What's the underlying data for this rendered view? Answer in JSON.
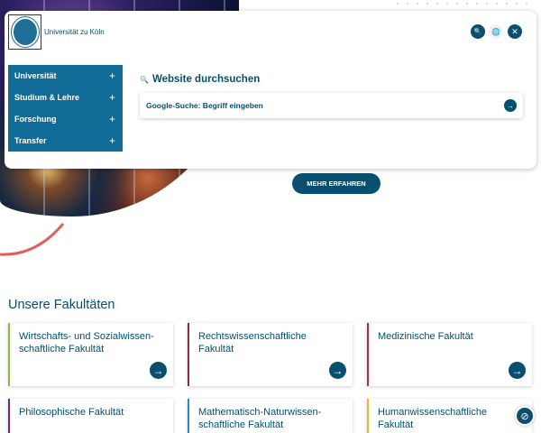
{
  "header": {
    "university_name": "Universität zu Köln",
    "logo_text": "Universität zu Köln"
  },
  "icons": {
    "search": "🔍",
    "globe": "🌐",
    "close": "✕",
    "arrow": "→",
    "compass": "⊘"
  },
  "menu": {
    "items": [
      {
        "label": "Universität"
      },
      {
        "label": "Studium & Lehre"
      },
      {
        "label": "Forschung"
      },
      {
        "label": "Transfer"
      }
    ],
    "expand_symbol": "+"
  },
  "search": {
    "title": "Website durchsuchen",
    "placeholder": "Google-Suche: Begriff eingeben"
  },
  "hero": {
    "button_label": "MEHR ERFAHREN"
  },
  "faculties": {
    "title": "Unsere Fakultäten",
    "items": [
      {
        "name": "Wirtschafts- und Sozialwissen-schaftliche Fakultät",
        "color": "#8cb83c"
      },
      {
        "name": "Rechtswissenschaftliche Fakultät",
        "color": "#8a2a3a"
      },
      {
        "name": "Medizinische Fakultät",
        "color": "#b03040"
      },
      {
        "name": "Philosophische Fakultät",
        "color": "#6a2a80"
      },
      {
        "name": "Mathematisch-Naturwissen-schaftliche Fakultät",
        "color": "#2a8ac8"
      },
      {
        "name": "Humanwissenschaftliche Fakultät",
        "color": "#e8b830"
      }
    ]
  }
}
